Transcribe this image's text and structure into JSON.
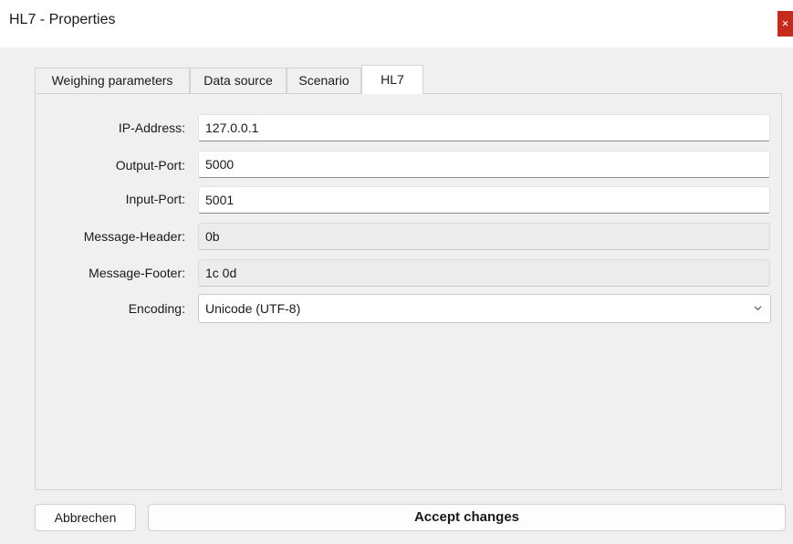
{
  "window": {
    "title": "HL7 - Properties",
    "close_glyph": "×"
  },
  "tabs": [
    {
      "label": "Weighing parameters",
      "active": false
    },
    {
      "label": "Data source",
      "active": false
    },
    {
      "label": "Scenario",
      "active": false
    },
    {
      "label": "HL7",
      "active": true
    }
  ],
  "form": {
    "ip_address": {
      "label": "IP-Address:",
      "value": "127.0.0.1"
    },
    "output_port": {
      "label": "Output-Port:",
      "value": "5000"
    },
    "input_port": {
      "label": "Input-Port:",
      "value": "5001"
    },
    "message_header": {
      "label": "Message-Header:",
      "value": "0b"
    },
    "message_footer": {
      "label": "Message-Footer:",
      "value": "1c 0d"
    },
    "encoding": {
      "label": "Encoding:",
      "value": "Unicode (UTF-8)"
    }
  },
  "buttons": {
    "cancel": "Abbrechen",
    "accept": "Accept changes"
  },
  "colors": {
    "close_button": "#c42b1c",
    "background": "#f0f0f0"
  }
}
